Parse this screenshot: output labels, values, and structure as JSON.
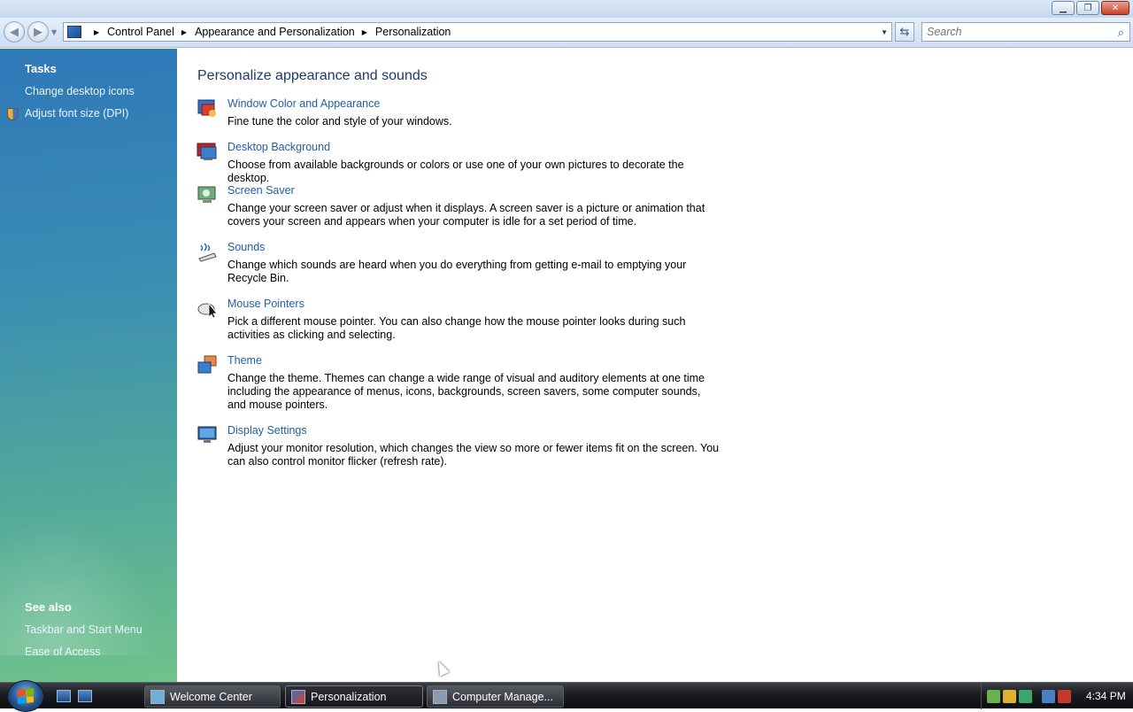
{
  "address_bar": {
    "crumbs": [
      "Control Panel",
      "Appearance and Personalization",
      "Personalization"
    ],
    "search_placeholder": "Search"
  },
  "left_pane": {
    "tasks_heading": "Tasks",
    "tasks": [
      "Change desktop icons",
      "Adjust font size (DPI)"
    ],
    "see_also_heading": "See also",
    "see_also": [
      "Taskbar and Start Menu",
      "Ease of Access"
    ]
  },
  "main": {
    "title": "Personalize appearance and sounds",
    "items": [
      {
        "label": "Window Color and Appearance",
        "desc": "Fine tune the color and style of your windows.",
        "icon": "window-color-icon"
      },
      {
        "label": "Desktop Background",
        "desc": "Choose from available backgrounds or colors or use one of your own pictures to decorate the desktop.",
        "icon": "desktop-background-icon"
      },
      {
        "label": "Screen Saver",
        "desc": "Change your screen saver or adjust when it displays. A screen saver is a picture or animation that covers your screen and appears when your computer is idle for a set period of time.",
        "icon": "screen-saver-icon"
      },
      {
        "label": "Sounds",
        "desc": "Change which sounds are heard when you do everything from getting e-mail to emptying your Recycle Bin.",
        "icon": "sounds-icon"
      },
      {
        "label": "Mouse Pointers",
        "desc": "Pick a different mouse pointer. You can also change how the mouse pointer looks during such activities as clicking and selecting.",
        "icon": "mouse-pointers-icon"
      },
      {
        "label": "Theme",
        "desc": "Change the theme. Themes can change a wide range of visual and auditory elements at one time including the appearance of menus, icons, backgrounds, screen savers, some computer sounds, and mouse pointers.",
        "icon": "theme-icon"
      },
      {
        "label": "Display Settings",
        "desc": "Adjust your monitor resolution, which changes the view so more or fewer items fit on the screen. You can also control monitor flicker (refresh rate).",
        "icon": "display-settings-icon"
      }
    ]
  },
  "taskbar": {
    "buttons": [
      "Welcome Center",
      "Personalization",
      "Computer Manage..."
    ],
    "active": "Personalization",
    "clock": "4:34 PM"
  },
  "colors": {
    "link": "#1f5fa8",
    "title": "#1e3a6a",
    "left_pane_top": "#2e78b8",
    "left_pane_bottom": "#6fc28a"
  }
}
